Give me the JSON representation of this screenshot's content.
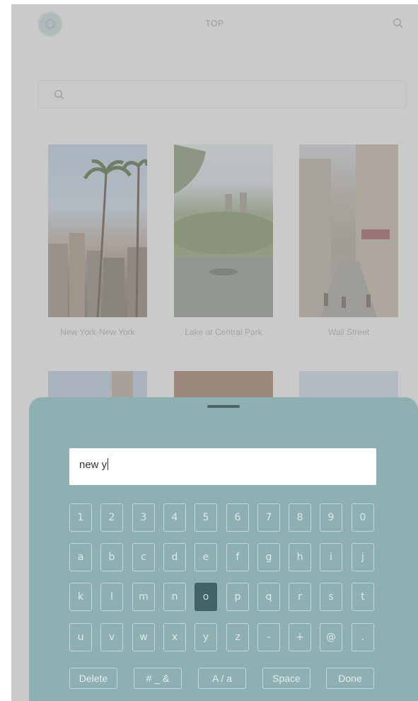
{
  "topbar": {
    "title": "TOP"
  },
  "grid": {
    "cards": [
      {
        "caption": "New York-New York"
      },
      {
        "caption": "Lake at Central Park"
      },
      {
        "caption": "Wall Street"
      },
      {
        "caption": ""
      },
      {
        "caption": ""
      },
      {
        "caption": ""
      }
    ]
  },
  "keyboard": {
    "input_value": "new y",
    "rows": [
      [
        "1",
        "2",
        "3",
        "4",
        "5",
        "6",
        "7",
        "8",
        "9",
        "0"
      ],
      [
        "a",
        "b",
        "c",
        "d",
        "e",
        "f",
        "g",
        "h",
        "i",
        "j"
      ],
      [
        "k",
        "l",
        "m",
        "n",
        "o",
        "p",
        "q",
        "r",
        "s",
        "t"
      ],
      [
        "u",
        "v",
        "w",
        "x",
        "y",
        "z",
        "-",
        "+",
        "@",
        "."
      ]
    ],
    "highlighted_key": "o",
    "functions": {
      "delete": "Delete",
      "symbols": "# _ &",
      "case": "A / a",
      "space": "Space",
      "done": "Done"
    }
  },
  "icons": {
    "logo": "globe-logo-icon",
    "top_search": "search-icon",
    "bar_search": "search-icon"
  },
  "colors": {
    "sheet": "#8fb0b3",
    "active_key": "#3f6366",
    "handle": "#4d6466"
  }
}
